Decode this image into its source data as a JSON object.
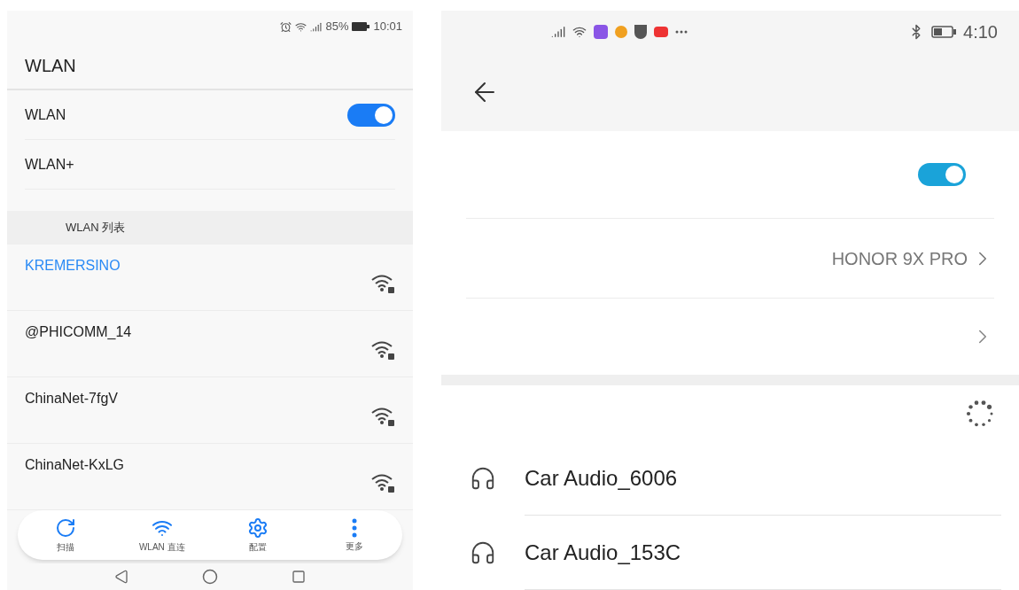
{
  "left_phone": {
    "status_bar": {
      "battery": "85%",
      "time": "10:01"
    },
    "title": "WLAN",
    "settings": [
      {
        "kind": "toggle",
        "label": "WLAN",
        "on": true
      },
      {
        "kind": "plain",
        "label": "WLAN+"
      }
    ],
    "section_header": "WLAN 列表",
    "networks": [
      {
        "name": "KREMERSINO",
        "selected": true
      },
      {
        "name": "@PHICOMM_14",
        "selected": false
      },
      {
        "name": "ChinaNet-7fgV",
        "selected": false
      },
      {
        "name": "ChinaNet-KxLG",
        "selected": false
      }
    ],
    "bottom_bar": [
      {
        "kind": "scan",
        "label": "扫描"
      },
      {
        "kind": "direct",
        "label": "WLAN 直连"
      },
      {
        "kind": "config",
        "label": "配置"
      },
      {
        "kind": "more",
        "label": "更多"
      }
    ]
  },
  "right_phone": {
    "status_bar": {
      "time": "4:10"
    },
    "bluetooth_on": true,
    "device_name": "HONOR 9X PRO",
    "devices": [
      {
        "name": "Car Audio_6006"
      },
      {
        "name": "Car Audio_153C"
      }
    ]
  }
}
